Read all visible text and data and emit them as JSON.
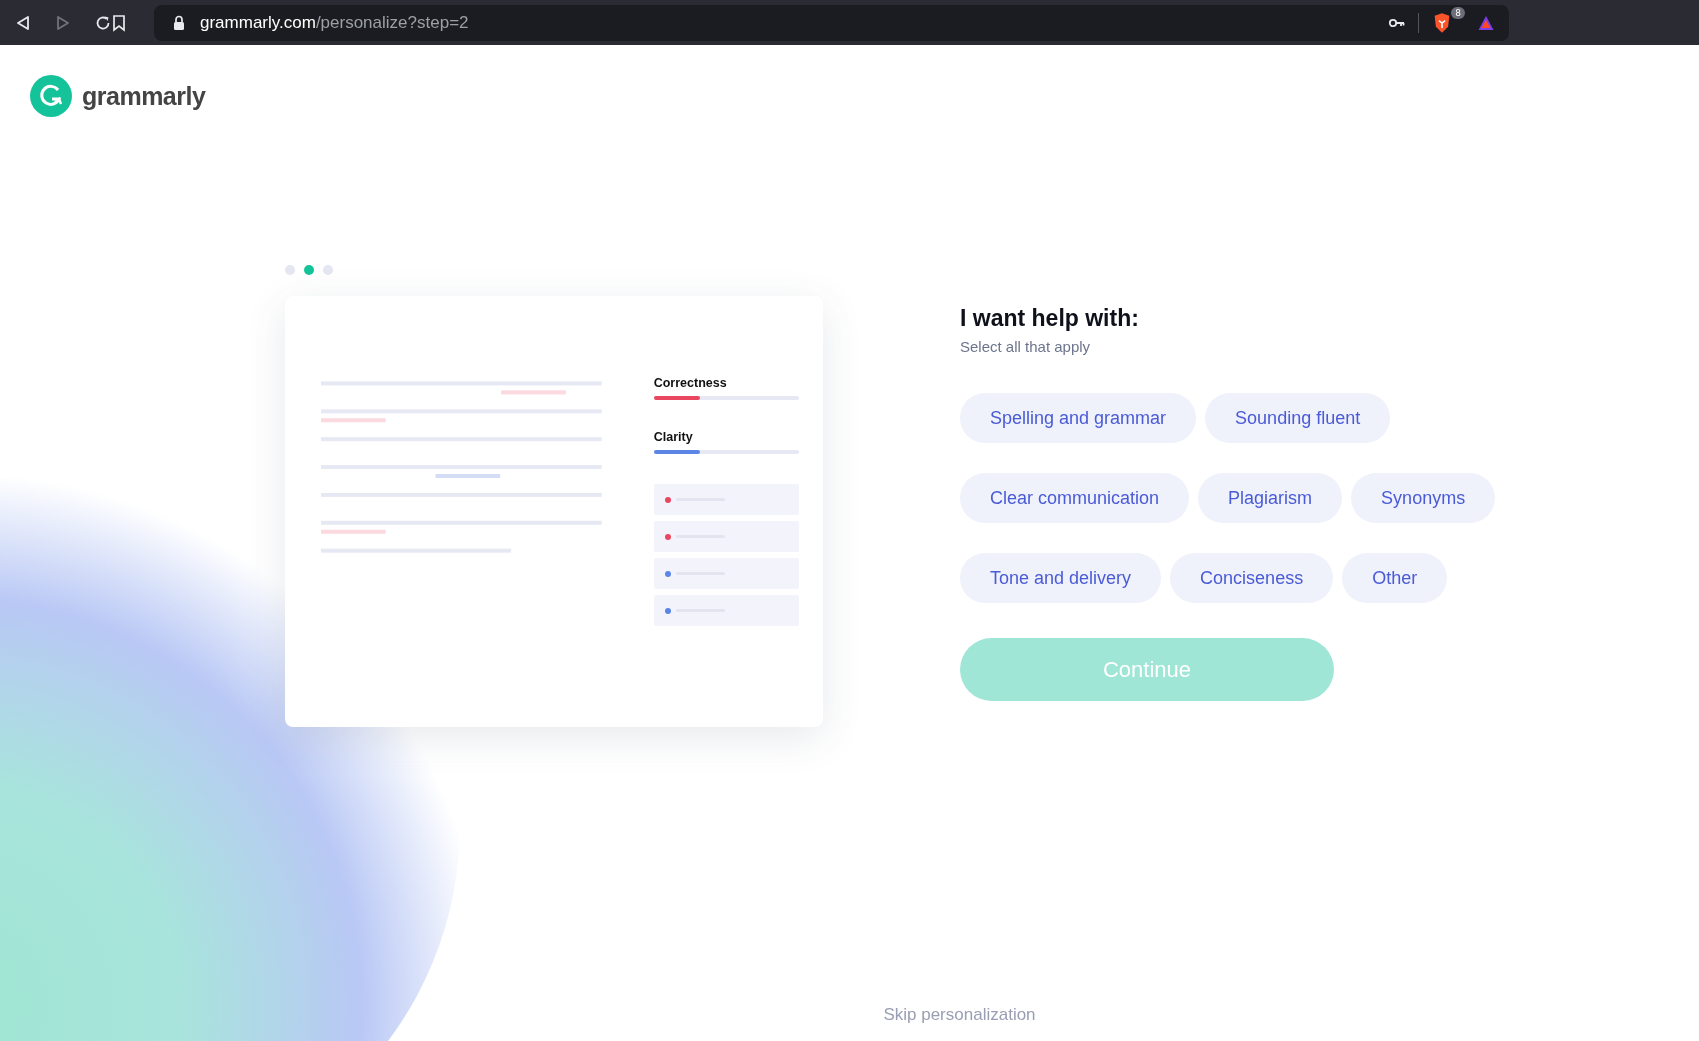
{
  "browser": {
    "url_host": "grammarly.com",
    "url_path": "/personalize?step=2",
    "extension_badge": "8"
  },
  "logo": {
    "wordmark": "grammarly"
  },
  "steps": [
    {
      "selected": false
    },
    {
      "selected": true
    },
    {
      "selected": false
    }
  ],
  "illustration": {
    "meters": [
      {
        "label": "Correctness",
        "color": "#e8475f",
        "level": 0.32
      },
      {
        "label": "Clarity",
        "color": "#5b86e5",
        "level": 0.32
      }
    ],
    "issues": [
      {
        "color": "#e8475f"
      },
      {
        "color": "#e8475f"
      },
      {
        "color": "#5b86e5"
      },
      {
        "color": "#5b86e5"
      }
    ]
  },
  "question": {
    "title": "I want help with:",
    "subtitle": "Select all that apply"
  },
  "option_rows": [
    [
      {
        "label": "Spelling and grammar",
        "selected": false
      },
      {
        "label": "Sounding fluent",
        "selected": false
      }
    ],
    [
      {
        "label": "Clear communication",
        "selected": false
      },
      {
        "label": "Plagiarism",
        "selected": false
      },
      {
        "label": "Synonyms",
        "selected": false
      }
    ],
    [
      {
        "label": "Tone and delivery",
        "selected": false
      },
      {
        "label": "Conciseness",
        "selected": false
      },
      {
        "label": "Other",
        "selected": false
      }
    ]
  ],
  "continue_button": {
    "label": "Continue",
    "disabled": true
  },
  "skip_link": "Skip personalization"
}
